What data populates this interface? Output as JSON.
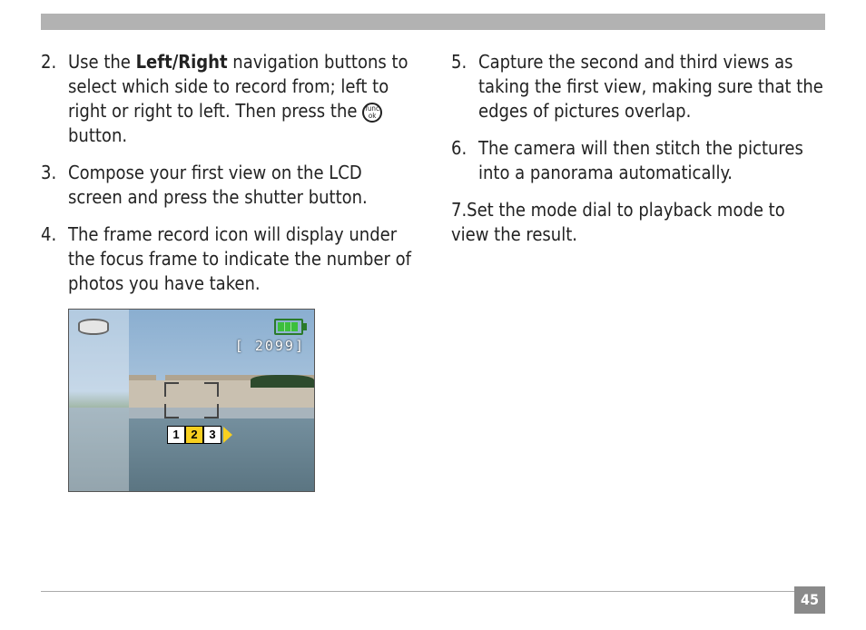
{
  "page_number": "45",
  "left_col": {
    "items": [
      {
        "num": "2. ",
        "pre": "Use the ",
        "bold": "Left/Right",
        "post": " navigation buttons to select which side to record from; left to right or right to left. Then press the ",
        "tail": " button."
      },
      {
        "num": "3. ",
        "text": "Compose your first view on the LCD screen and press the shutter button."
      },
      {
        "num": "4. ",
        "text": "The frame record icon will display under the focus frame to indicate the number of photos you have taken."
      }
    ]
  },
  "right_col": {
    "items": [
      {
        "num": "5. ",
        "text": "Capture the second and third views as taking the first view, making sure that the edges of pictures overlap."
      },
      {
        "num": "6. ",
        "text": "The camera will then stitch the pictures into a panorama automatically."
      },
      {
        "num": "7.",
        "text": "Set the mode dial to playback mode to view the result."
      }
    ]
  },
  "func_icon": {
    "top_label": "func",
    "bottom_label": "ok"
  },
  "lcd": {
    "counter_text": "[  2099]",
    "frame_1": "1",
    "frame_2": "2",
    "frame_3": "3"
  }
}
